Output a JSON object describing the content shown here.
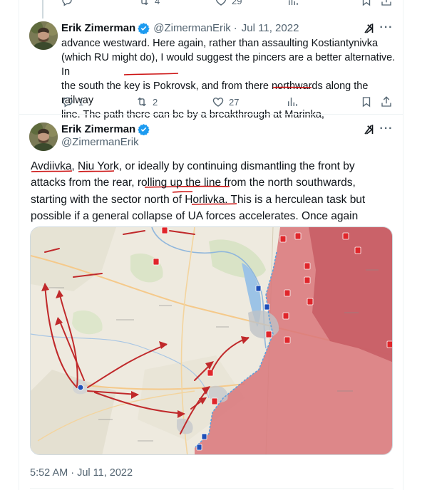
{
  "top_actions": {
    "retweets": "4",
    "likes": "29"
  },
  "reply": {
    "author_name": "Erik Zimerman",
    "author_handle": "@ZimermanErik",
    "separator": "·",
    "date": "Jul 11, 2022",
    "text_lines": [
      "advance westward. Here again, rather than assaulting Kostiantynivka",
      "(which RU might do), I would suggest the pincers are a better alternative. In",
      "the south the key is Pokrovsk, and from there northwards along the railway",
      "line. The path there can be by a breakthrough at Marinka,"
    ],
    "replies": "1",
    "retweets": "2",
    "likes": "27"
  },
  "main": {
    "author_name": "Erik Zimerman",
    "author_handle": "@ZimermanErik",
    "text_lines": [
      "Avdiivka, Niu York, or ideally by continuing dismantling the front by",
      "attacks from the rear, rolling up the line from the north southwards,",
      "starting with the sector north of Horlivka. This is a herculean task but",
      "possible if a general collapse of UA forces accelerates. Once again"
    ],
    "timestamp": "5:52 AM · Jul 11, 2022"
  },
  "colors": {
    "text": "#0f1419",
    "secondary": "#536471",
    "verified": "#1d9bf0",
    "ink_underline": "#cc1111",
    "occupied_territory": "#d9757a",
    "map_land": "#eeeadf",
    "arrow": "#c0292b"
  },
  "icons": [
    "reply-icon",
    "retweet-icon",
    "like-icon",
    "views-icon",
    "bookmark-icon",
    "share-icon",
    "grok-icon",
    "more-icon",
    "verified-badge-icon"
  ]
}
